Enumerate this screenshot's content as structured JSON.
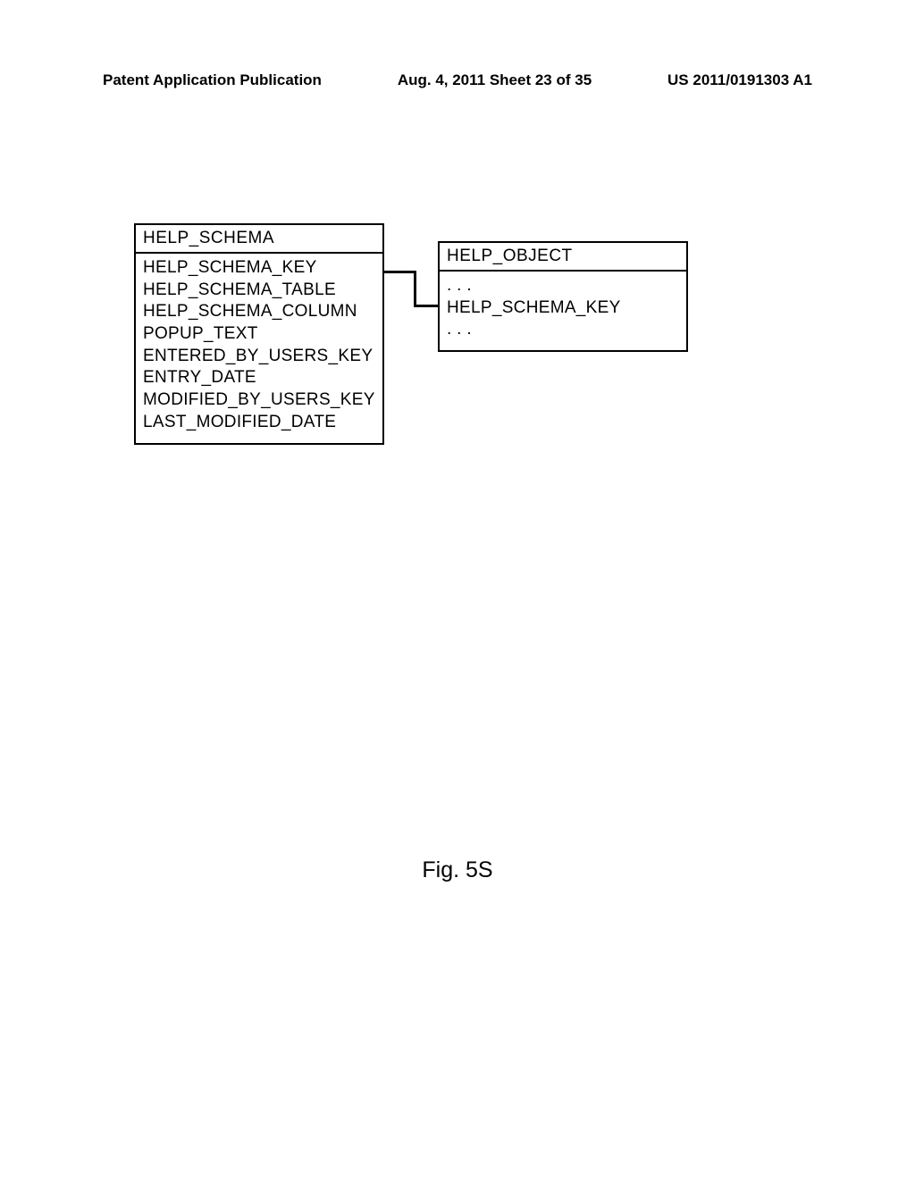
{
  "header": {
    "left": "Patent Application Publication",
    "center": "Aug. 4, 2011  Sheet 23 of 35",
    "right": "US 2011/0191303 A1"
  },
  "diagram": {
    "entity_left": {
      "title": "HELP_SCHEMA",
      "fields": [
        "HELP_SCHEMA_KEY",
        "HELP_SCHEMA_TABLE",
        "HELP_SCHEMA_COLUMN",
        "POPUP_TEXT",
        "ENTERED_BY_USERS_KEY",
        "ENTRY_DATE",
        "MODIFIED_BY_USERS_KEY",
        "LAST_MODIFIED_DATE"
      ]
    },
    "entity_right": {
      "title": "HELP_OBJECT",
      "fields": [
        ". . .",
        "HELP_SCHEMA_KEY",
        ". . ."
      ]
    }
  },
  "figure_label": "Fig. 5S"
}
